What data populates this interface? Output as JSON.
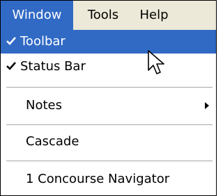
{
  "menubar": {
    "items": [
      {
        "label": "Window",
        "active": true
      },
      {
        "label": "Tools",
        "active": false
      },
      {
        "label": "Help",
        "active": false
      }
    ]
  },
  "menu": {
    "items": [
      {
        "label": "Toolbar",
        "checked": true,
        "highlighted": true,
        "has_submenu": false
      },
      {
        "label": "Status Bar",
        "checked": true,
        "highlighted": false,
        "has_submenu": false
      },
      {
        "label": "Notes",
        "checked": false,
        "highlighted": false,
        "has_submenu": true
      },
      {
        "label": "Cascade",
        "checked": false,
        "highlighted": false,
        "has_submenu": false
      },
      {
        "label": "1 Concourse Navigator",
        "checked": false,
        "highlighted": false,
        "has_submenu": false
      }
    ]
  },
  "icons": {
    "check": "checkmark-icon",
    "submenu": "submenu-arrow-icon",
    "cursor": "mouse-pointer-icon"
  },
  "colors": {
    "highlight": "#316ac5",
    "menubar_bg": "#ece9d8",
    "menu_bg": "#ffffff",
    "separator": "#a7a6aa"
  }
}
